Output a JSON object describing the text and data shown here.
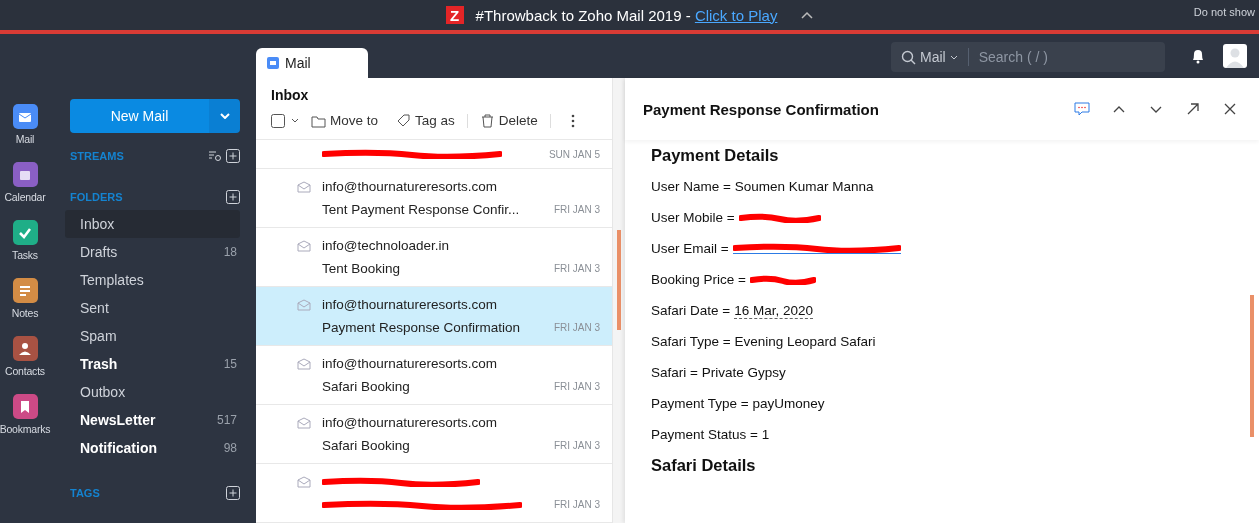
{
  "banner": {
    "logo": "Z",
    "text": "#Throwback to Zoho Mail 2019 - ",
    "link": "Click to Play",
    "dismiss": "Do not show"
  },
  "header": {
    "search_scope": "Mail",
    "search_placeholder": "Search ( / )"
  },
  "tabs": [
    {
      "label": "Mail",
      "selected": true
    }
  ],
  "apps": [
    {
      "label": "Mail",
      "color": "#4a8cf7",
      "kind": "mail"
    },
    {
      "label": "Calendar",
      "color": "#8a5fc4",
      "kind": "calendar"
    },
    {
      "label": "Tasks",
      "color": "#1fae87",
      "kind": "tasks"
    },
    {
      "label": "Notes",
      "color": "#d38c45",
      "kind": "notes"
    },
    {
      "label": "Contacts",
      "color": "#a85243",
      "kind": "contacts"
    },
    {
      "label": "Bookmarks",
      "color": "#cc4a86",
      "kind": "bookmarks"
    }
  ],
  "new_mail": "New Mail",
  "streams_label": "STREAMS",
  "folders_label": "FOLDERS",
  "folders": [
    {
      "label": "Inbox",
      "selected": true,
      "unread": false
    },
    {
      "label": "Drafts",
      "count": "18",
      "selected": false,
      "unread": false
    },
    {
      "label": "Templates",
      "selected": false,
      "unread": false
    },
    {
      "label": "Sent",
      "selected": false,
      "unread": false
    },
    {
      "label": "Spam",
      "selected": false,
      "unread": false
    },
    {
      "label": "Trash",
      "count": "15",
      "selected": false,
      "unread": true
    },
    {
      "label": "Outbox",
      "selected": false,
      "unread": false
    },
    {
      "label": "NewsLetter",
      "count": "517",
      "selected": false,
      "unread": true
    },
    {
      "label": "Notification",
      "count": "98",
      "selected": false,
      "unread": true
    }
  ],
  "tags_label": "TAGS",
  "list": {
    "title": "Inbox",
    "select_all_checked": false,
    "toolbar": [
      "Move to",
      "Tag as",
      "Delete"
    ],
    "messages": [
      {
        "kind": "redacted-cut",
        "date": "SUN JAN 5",
        "selected": false
      },
      {
        "kind": "mail",
        "sender": "info@thournatureresorts.com",
        "subject": "Tent Payment Response Confir...",
        "date": "FRI JAN 3",
        "selected": false
      },
      {
        "kind": "mail",
        "sender": "info@technoloader.in",
        "subject": "Tent Booking",
        "date": "FRI JAN 3",
        "selected": false
      },
      {
        "kind": "mail",
        "sender": "info@thournatureresorts.com",
        "subject": "Payment Response Confirmation",
        "date": "FRI JAN 3",
        "selected": true
      },
      {
        "kind": "mail",
        "sender": "info@thournatureresorts.com",
        "subject": "Safari Booking",
        "date": "FRI JAN 3",
        "selected": false
      },
      {
        "kind": "mail",
        "sender": "info@thournatureresorts.com",
        "subject": "Safari Booking",
        "date": "FRI JAN 3",
        "selected": false
      },
      {
        "kind": "redacted",
        "date": "FRI JAN 3",
        "selected": false
      }
    ]
  },
  "reader": {
    "title": "Payment Response Confirmation",
    "lines": [
      {
        "kind": "heading",
        "text": "Payment Details"
      },
      {
        "kind": "field",
        "text": "User Name = Soumen Kumar Manna"
      },
      {
        "kind": "redacted",
        "text": "User Mobile ="
      },
      {
        "kind": "redacted-link",
        "text": "User Email ="
      },
      {
        "kind": "redacted",
        "text": "Booking Price ="
      },
      {
        "kind": "date",
        "text": "Safari Date =",
        "value": "16 Mar, 2020"
      },
      {
        "kind": "field",
        "text": "Safari Type = Evening Leopard Safari"
      },
      {
        "kind": "field",
        "text": "Safari = Private Gypsy"
      },
      {
        "kind": "field",
        "text": "Payment Type = payUmoney"
      },
      {
        "kind": "field",
        "text": "Payment Status = 1"
      },
      {
        "kind": "heading",
        "text": "Safari Details"
      }
    ]
  }
}
